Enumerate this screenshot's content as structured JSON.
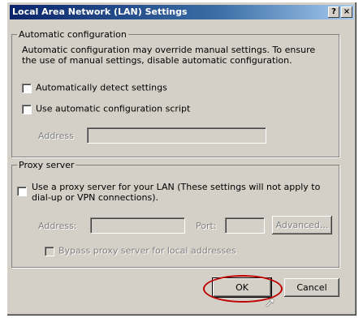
{
  "window": {
    "title": "Local Area Network (LAN) Settings",
    "help_label": "?",
    "close_label": "×"
  },
  "auto_config": {
    "legend": "Automatic configuration",
    "description": "Automatic configuration may override manual settings.  To ensure the use of manual settings, disable automatic configuration.",
    "detect_label": "Automatically detect settings",
    "script_label": "Use automatic configuration script",
    "address_label": "Address",
    "address_value": ""
  },
  "proxy": {
    "legend": "Proxy server",
    "use_proxy_label": "Use a proxy server for your LAN (These settings will not apply to dial-up or VPN connections).",
    "address_label": "Address:",
    "address_value": "",
    "port_label": "Port:",
    "port_value": "",
    "advanced_label": "Advanced...",
    "bypass_label": "Bypass proxy server for local addresses"
  },
  "buttons": {
    "ok_label": "OK",
    "cancel_label": "Cancel"
  },
  "colors": {
    "dialog_face": "#d4d0c8",
    "titlebar_start": "#0a246a",
    "annotation": "#c00000"
  }
}
